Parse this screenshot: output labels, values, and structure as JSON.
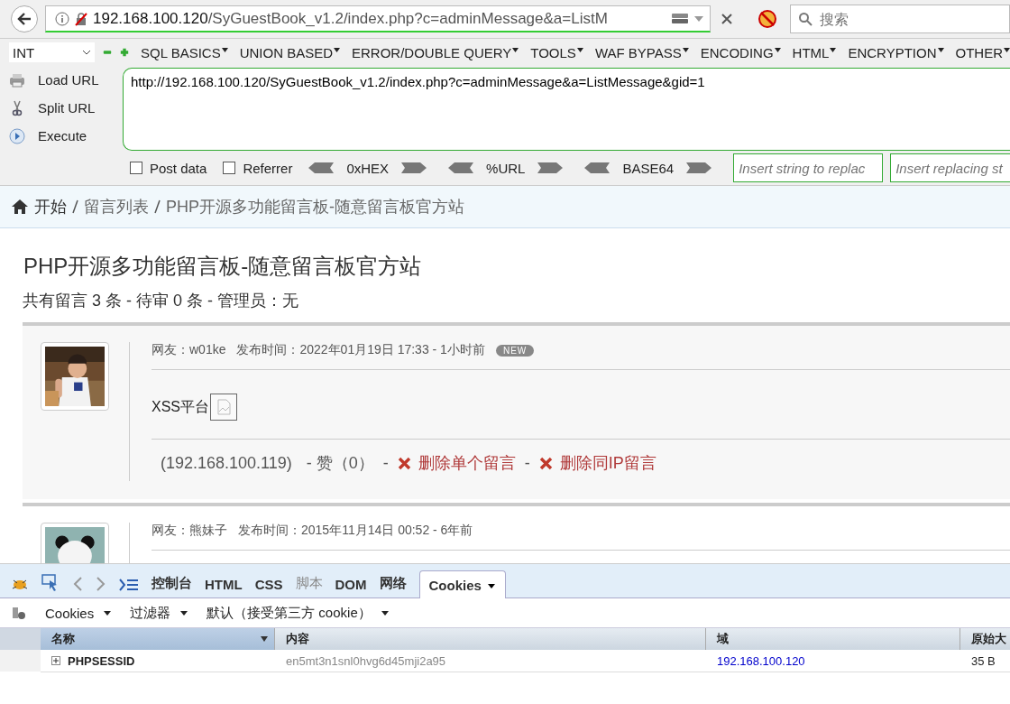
{
  "address_bar": {
    "host": "192.168.100.120",
    "path": "/SyGuestBook_v1.2/index.php?c=adminMessage&a=ListM",
    "search_placeholder": "搜索"
  },
  "hackbar": {
    "select_value": "INT",
    "menus": [
      "SQL BASICS",
      "UNION BASED",
      "ERROR/DOUBLE QUERY",
      "TOOLS",
      "WAF BYPASS",
      "ENCODING",
      "HTML",
      "ENCRYPTION",
      "OTHER"
    ],
    "actions": [
      {
        "kind": "load",
        "label": "Load URL"
      },
      {
        "kind": "split",
        "label": "Split URL"
      },
      {
        "kind": "execute",
        "label": "Execute"
      }
    ],
    "url_value": "http://192.168.100.120/SyGuestBook_v1.2/index.php?c=adminMessage&a=ListMessage&gid=1",
    "options": [
      {
        "label": "Post data",
        "checked": false
      },
      {
        "label": "Referrer",
        "checked": false
      }
    ],
    "encoders": [
      "0xHEX",
      "%URL",
      "BASE64"
    ],
    "replace_placeholders": [
      "Insert string to replac",
      "Insert replacing st"
    ]
  },
  "breadcrumb": [
    "开始",
    "留言列表",
    "PHP开源多功能留言板-随意留言板官方站"
  ],
  "title": "PHP开源多功能留言板-随意留言板官方站",
  "summary": "共有留言 3 条 - 待审 0 条 - 管理员：无",
  "messages": [
    {
      "user": "网友：w01ke",
      "time": "发布时间：2022年01月19日 17:33 - 1小时前",
      "badge": "NEW",
      "content": "XSS平台",
      "ip": "(192.168.100.119)",
      "likes": "- 赞（0）",
      "actions": [
        {
          "prefix": "-",
          "label": "删除单个留言"
        },
        {
          "prefix": "-",
          "label": "删除同IP留言"
        }
      ]
    },
    {
      "user": "网友：熊妹子",
      "time": "发布时间：2015年11月14日 00:52 - 6年前"
    }
  ],
  "devtools": {
    "tabs": [
      {
        "label": "控制台",
        "selected": false,
        "disabled": false
      },
      {
        "label": "HTML",
        "selected": false,
        "disabled": false
      },
      {
        "label": "CSS",
        "selected": false,
        "disabled": false
      },
      {
        "label": "脚本",
        "selected": false,
        "disabled": true
      },
      {
        "label": "DOM",
        "selected": false,
        "disabled": false
      },
      {
        "label": "网络",
        "selected": false,
        "disabled": false
      },
      {
        "label": "Cookies",
        "selected": true,
        "disabled": false
      }
    ],
    "menus": [
      "Cookies",
      "过滤器",
      "默认（接受第三方 cookie）"
    ],
    "columns": [
      "名称",
      "内容",
      "域",
      "原始大"
    ],
    "rows": [
      {
        "name": "PHPSESSID",
        "value": "en5mt3n1snl0hvg6d45mji2a95",
        "domain": "192.168.100.120",
        "size": "35 B"
      }
    ]
  }
}
